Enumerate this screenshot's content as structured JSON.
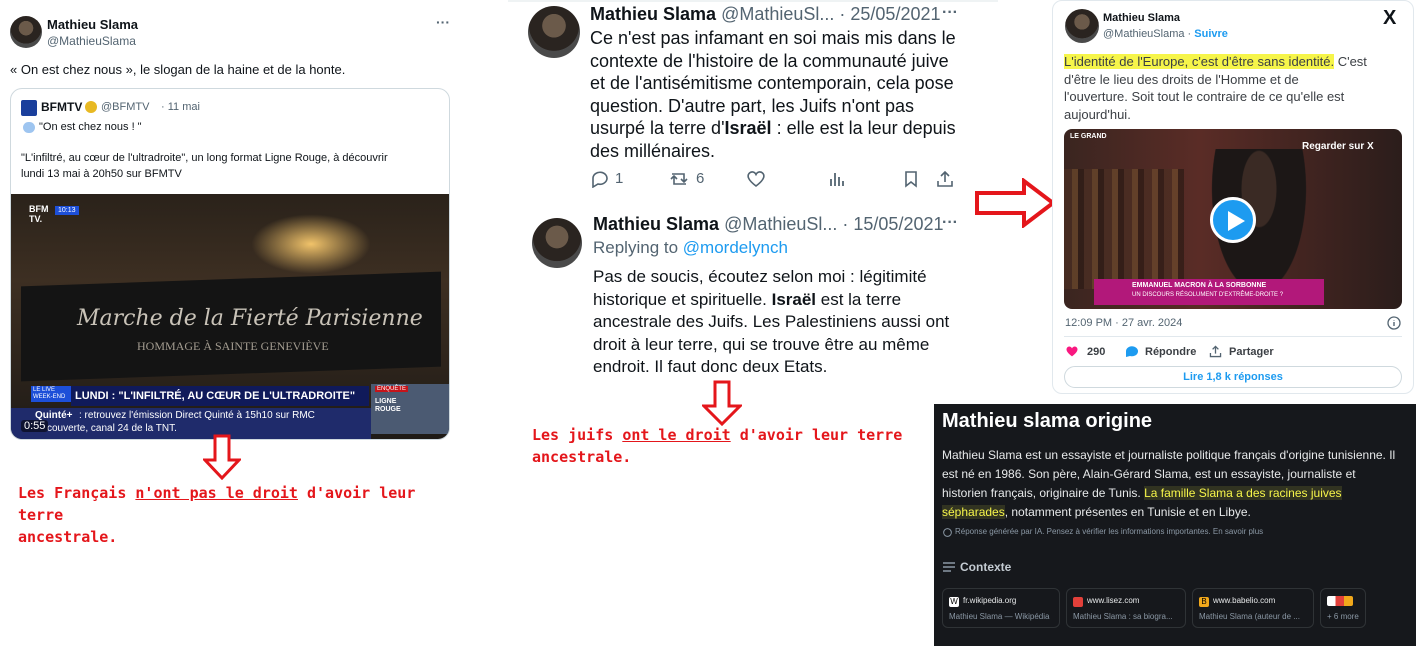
{
  "panel1": {
    "author": "Mathieu Slama",
    "handle": "@MathieuSlama",
    "more": "···",
    "text": "« On est chez nous », le slogan de la haine et de la honte.",
    "quote": {
      "source_name": "BFMTV",
      "source_handle": "@BFMTV",
      "date": "· 11 mai",
      "line1": "\"On est chez nous ! \"",
      "line2": "\"L'infiltré, au cœur de l'ultradroite\", un long format Ligne Rouge, à découvrir",
      "line3": "lundi 13 mai à 20h50 sur BFMTV"
    },
    "video": {
      "logo": "BFM TV.",
      "logo_time": "10:13",
      "banner_line1": "Marche de la Fierté Parisienne",
      "banner_line2": "HOMMAGE À SAINTE GENEVIÈVE",
      "live_tag": "LE LIVE WEEK-END",
      "headline": "LUNDI : \"L'INFILTRÉ, AU CŒUR DE L'ULTRADROITE\"",
      "ticker_brand": "Quinté+",
      "ticker_text": ": retrouvez l'émission Direct Quinté à 15h10 sur RMC",
      "ticker_text2": "couverte, canal 24 de la TNT.",
      "duration": "0:55",
      "side_label1": "LIGNE",
      "side_label2": "ROUGE",
      "side_label3": "ENQUÊTE"
    },
    "note_part1": "Les Français ",
    "note_underlined": "n'ont pas le droit",
    "note_part2": " d'avoir leur terre",
    "note_line2": "ancestrale."
  },
  "panel2": {
    "tweet1": {
      "author": "Mathieu Slama",
      "handle": "@MathieuSl...",
      "date": "· 25/05/2021",
      "more": "···",
      "line1": "Ce n'est pas infamant en soi mais mis dans le",
      "line2": "contexte de l'histoire de la communauté juive",
      "line3": "et de l'antisémitisme contemporain, cela pose",
      "line4": "question. D'autre part, les Juifs n'ont pas",
      "line5a": "usurpé la terre d'",
      "line5b": "Israël",
      "line5c": " : elle est la leur depuis",
      "line6": "des millénaires.",
      "replies": "1",
      "retweets": "6"
    },
    "tweet2": {
      "author": "Mathieu Slama",
      "handle": "@MathieuSl...",
      "date": "· 15/05/2021",
      "more": "···",
      "replying_label": "Replying to ",
      "replying_to": "@mordelynch",
      "line1": "Pas de soucis, écoutez selon moi : légitimité",
      "line2a": "historique et spirituelle. ",
      "line2b": "Israël",
      "line2c": " est la terre",
      "line3": "ancestrale des Juifs. Les Palestiniens aussi ont",
      "line4": "droit à leur terre, qui se trouve être au même",
      "line5": "endroit. Il faut donc deux Etats."
    },
    "note_part1": "Les juifs ",
    "note_underlined": "ont le droit",
    "note_part2": " d'avoir leur terre",
    "note_line2": "ancestrale."
  },
  "panel3": {
    "author": "Mathieu Slama",
    "handle": "@MathieuSlama",
    "dot": " · ",
    "follow": "Suivre",
    "x_logo": "X",
    "text_highlight": "L'identité de l'Europe, c'est d'être sans identité.",
    "text_rest1": " C'est",
    "text_line2": "d'être le lieu des droits de l'Homme et de",
    "text_line3": "l'ouverture. Soit tout le contraire de ce qu'elle est",
    "text_line4": "aujourd'hui.",
    "video_watch": "Regarder sur X",
    "video_brand": "LE GRAND",
    "video_banner1": "EMMANUEL MACRON À LA SORBONNE",
    "video_banner2": "UN DISCOURS RÉSOLUMENT D'EXTRÊME-DROITE ?",
    "timestamp": "12:09 PM · 27 avr. 2024",
    "likes": "290",
    "reply": "Répondre",
    "share": "Partager",
    "read_replies": "Lire 1,8 k réponses"
  },
  "panel4": {
    "title": "Mathieu slama origine",
    "p1": "Mathieu Slama est un essayiste et journaliste politique français d'origine tunisienne. Il",
    "p2": "est né en 1986. Son père, Alain-Gérard Slama, est un essayiste, journaliste et",
    "p3a": "historien français, originaire de Tunis. ",
    "p3b": "La famille Slama a des racines juives",
    "p4a": "sépharades",
    "p4b": ", notamment présentes en Tunisie et en Libye.",
    "ai_note": "Réponse générée par IA. Pensez à vérifier les informations importantes. En savoir plus",
    "context_label": "Contexte",
    "sources": [
      {
        "site": "fr.wikipedia.org",
        "desc": "Mathieu Slama — Wikipédia",
        "icon": "W"
      },
      {
        "site": "www.lisez.com",
        "desc": "Mathieu Slama : sa biogra...",
        "icon": "L"
      },
      {
        "site": "www.babelio.com",
        "desc": "Mathieu Slama (auteur de ...",
        "icon": "B"
      }
    ],
    "more_sources": "+ 6 more"
  },
  "colors": {
    "red_accent": "#e4161b",
    "x_blue": "#1d9bf0",
    "highlight_yellow": "#f6f54a",
    "dark_panel": "#16181c"
  }
}
